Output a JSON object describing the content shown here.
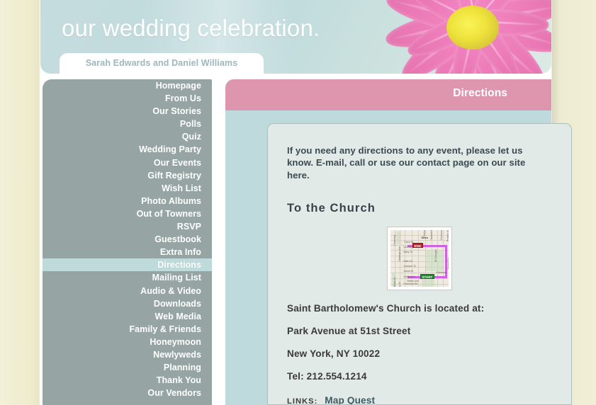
{
  "banner": {
    "title": "our wedding celebration.",
    "couple_names": "Sarah Edwards and Daniel Williams",
    "flower_icon": "pink-gerbera-flower-icon",
    "background_color": "#BFDADC"
  },
  "sidebar": {
    "background_color": "#96A5A3",
    "active_background_color": "#BEDADB",
    "items": [
      {
        "label": "Homepage",
        "active": false
      },
      {
        "label": "From Us",
        "active": false
      },
      {
        "label": "Our Stories",
        "active": false
      },
      {
        "label": "Polls",
        "active": false
      },
      {
        "label": "Quiz",
        "active": false
      },
      {
        "label": "Wedding Party",
        "active": false
      },
      {
        "label": "Our Events",
        "active": false
      },
      {
        "label": "Gift Registry",
        "active": false
      },
      {
        "label": "Wish List",
        "active": false
      },
      {
        "label": "Photo Albums",
        "active": false
      },
      {
        "label": "Out of Towners",
        "active": false
      },
      {
        "label": "RSVP",
        "active": false
      },
      {
        "label": "Guestbook",
        "active": false
      },
      {
        "label": "Extra Info",
        "active": false
      },
      {
        "label": "Directions",
        "active": true
      },
      {
        "label": "Mailing List",
        "active": false
      },
      {
        "label": "Audio & Video",
        "active": false
      },
      {
        "label": "Downloads",
        "active": false
      },
      {
        "label": "Web Media",
        "active": false
      },
      {
        "label": "Family & Friends",
        "active": false
      },
      {
        "label": "Honeymoon",
        "active": false
      },
      {
        "label": "Newlyweds",
        "active": false
      },
      {
        "label": "Planning",
        "active": false
      },
      {
        "label": "Thank You",
        "active": false
      },
      {
        "label": "Our Vendors",
        "active": false
      }
    ]
  },
  "page": {
    "header_title": "Directions",
    "header_color": "#DE96AE",
    "panel_color": "#E2EAE8",
    "intro_text": "If you need any directions to any event, please let us know. E-mail, call or use our contact page on our site here.",
    "section_heading": "To the Church",
    "map": {
      "icon": "route-map-thumbnail",
      "start_label": "START",
      "end_label": "END",
      "route_color": "#CF62E0",
      "start_color": "#1E8A2E",
      "end_color": "#C0202A",
      "street_names": [
        "Serra",
        "Flora St",
        "Lindsay Dr",
        "Mary St",
        "Ellen St",
        "October St",
        "David St",
        "Wellington",
        "Bates Ave",
        "Fairmont Rd",
        "Davina St",
        "Channing Dr",
        "Wellington St",
        "Kitchener",
        "Talbot Rd",
        "Preston Ave",
        "Wallace Av"
      ]
    },
    "address": {
      "line1": "Saint Bartholomew's Church is located at:",
      "line2": "Park Avenue at 51st Street",
      "line3": "New York, NY  10022",
      "line4": "Tel: 212.554.1214"
    },
    "links": {
      "label": "LINKS:",
      "value": "Map Quest"
    }
  }
}
